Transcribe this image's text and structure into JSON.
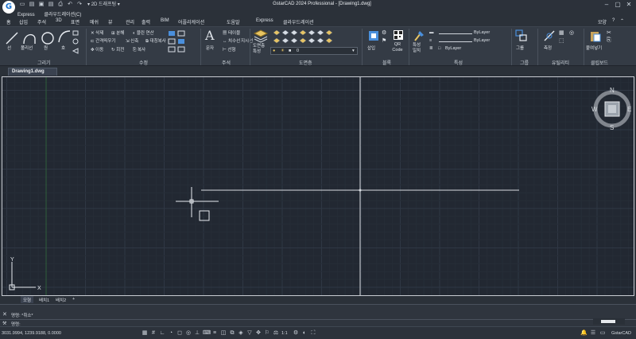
{
  "app": {
    "logo": "G",
    "title": "GstarCAD 2024 Professional - [Drawing1.dwg]",
    "workspace": "2D 드래프팅"
  },
  "menu1": [
    "Express",
    "클라우드레이션(C)"
  ],
  "ribbon_tabs": [
    "홈",
    "삽입",
    "주석",
    "3D",
    "표면",
    "메쉬",
    "뷰",
    "관리",
    "출력",
    "BIM",
    "어플리케이션",
    "도움말",
    "Express",
    "클라우드레이션"
  ],
  "ribbon_right": "모양",
  "panels": {
    "draw": {
      "title": "그리기",
      "buttons": [
        "선",
        "폴리선",
        "원",
        "호"
      ]
    },
    "modify": {
      "title": "수정",
      "buttons": [
        "삭제",
        "분해",
        "블린 연산",
        "간격띄우기",
        "신축",
        "대칭복사",
        "이동",
        "회전",
        "복사"
      ]
    },
    "annotation": {
      "title": "주석",
      "buttons": [
        "문자",
        "테이블",
        "치수선",
        "지시선",
        "선형"
      ]
    },
    "layers": {
      "title": "도면층",
      "buttons": [
        "도면층 특성"
      ],
      "current_layer": "0"
    },
    "block": {
      "title": "블록",
      "buttons": [
        "삽입",
        "QR Code"
      ]
    },
    "properties": {
      "title": "특성",
      "buttons": [
        "특성 일치"
      ],
      "bylayer": [
        "ByLayer",
        "ByLayer",
        "ByLayer"
      ]
    },
    "group": {
      "title": "그룹",
      "buttons": [
        "그룹"
      ]
    },
    "utilities": {
      "title": "유틸리티",
      "buttons": [
        "측정"
      ]
    },
    "clipboard": {
      "title": "클립보드",
      "buttons": [
        "붙여넣기"
      ]
    }
  },
  "doc_tab": "Drawing1.dwg",
  "layout_tabs": [
    "모형",
    "배치1",
    "배치2",
    "+"
  ],
  "command": {
    "line1": "명령: *취소*",
    "prompt": "명령:"
  },
  "status": {
    "coords": "3031.9994, 1239.9188, 0.0000",
    "scale": "1:1",
    "brand": "GstarCAD"
  },
  "viewcube": {
    "n": "N",
    "s": "S",
    "e": "E",
    "w": "W"
  },
  "ucs": {
    "x": "X",
    "y": "Y"
  },
  "colors": {
    "canvas": "#222832",
    "ribbon": "#343b45",
    "accent": "#1b72d1",
    "grid_major": "#2f3744",
    "grid_minor": "#262d37"
  }
}
